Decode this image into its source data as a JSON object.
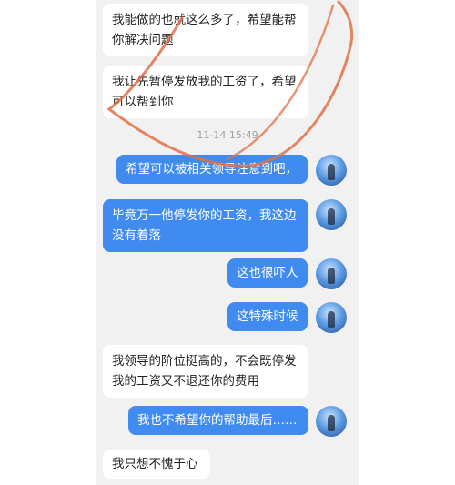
{
  "timestamp": "11-14 15:49",
  "messages": [
    {
      "side": "left",
      "text": "我能做的也就这么多了，希望能帮你解决问题"
    },
    {
      "side": "left",
      "text": "我让先暂停发放我的工资了，希望可以帮到你"
    },
    {
      "side": "right",
      "text": "希望可以被相关领导注意到吧，"
    },
    {
      "side": "right",
      "text": "毕竟万一他停发你的工资，我这边没有着落"
    },
    {
      "side": "right",
      "text": "这也很吓人"
    },
    {
      "side": "right",
      "text": "这特殊时候"
    },
    {
      "side": "left",
      "text": "我领导的阶位挺高的，不会既停发我的工资又不退还你的费用"
    },
    {
      "side": "right",
      "text": "我也不希望你的帮助最后……"
    },
    {
      "side": "left",
      "text": "我只想不愧于心"
    }
  ],
  "avatar_icon": "avatar-blue-sky",
  "colors": {
    "sent_bubble": "#3f8bf0",
    "received_bubble": "#ffffff",
    "background": "#f1f1f1",
    "annotation": "#e07048"
  }
}
